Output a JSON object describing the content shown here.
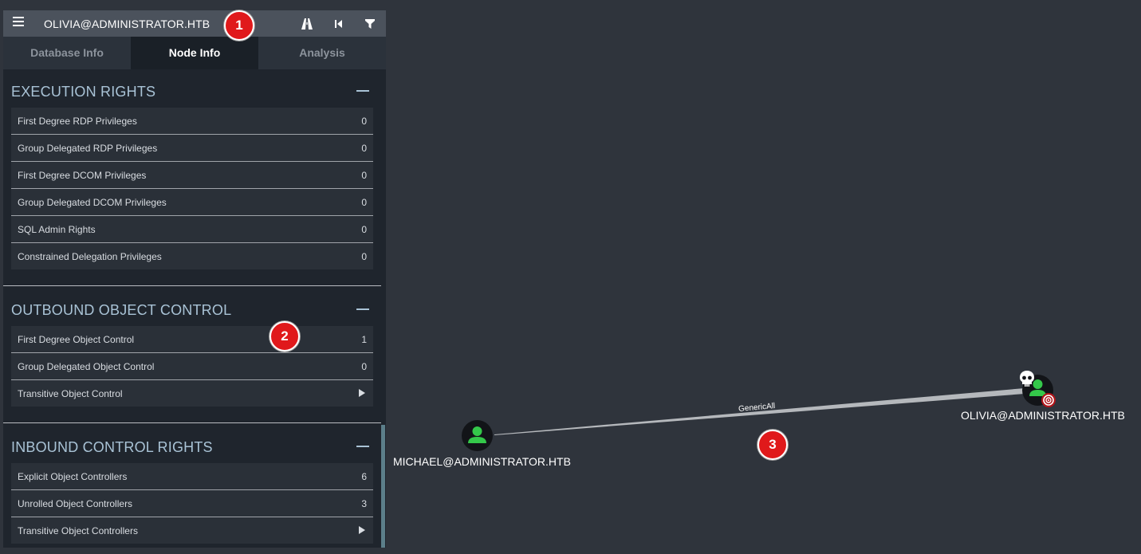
{
  "header": {
    "title": "OLIVIA@ADMINISTRATOR.HTB"
  },
  "tabs": [
    {
      "label": "Database Info",
      "active": false
    },
    {
      "label": "Node Info",
      "active": true
    },
    {
      "label": "Analysis",
      "active": false
    }
  ],
  "sections": {
    "execution": {
      "title": "EXECUTION RIGHTS",
      "rows": [
        {
          "label": "First Degree RDP Privileges",
          "value": "0"
        },
        {
          "label": "Group Delegated RDP Privileges",
          "value": "0"
        },
        {
          "label": "First Degree DCOM Privileges",
          "value": "0"
        },
        {
          "label": "Group Delegated DCOM Privileges",
          "value": "0"
        },
        {
          "label": "SQL Admin Rights",
          "value": "0"
        },
        {
          "label": "Constrained Delegation Privileges",
          "value": "0"
        }
      ]
    },
    "outbound": {
      "title": "OUTBOUND OBJECT CONTROL",
      "rows": [
        {
          "label": "First Degree Object Control",
          "value": "1"
        },
        {
          "label": "Group Delegated Object Control",
          "value": "0"
        },
        {
          "label": "Transitive Object Control",
          "value": ""
        }
      ]
    },
    "inbound": {
      "title": "INBOUND CONTROL RIGHTS",
      "rows": [
        {
          "label": "Explicit Object Controllers",
          "value": "6"
        },
        {
          "label": "Unrolled Object Controllers",
          "value": "3"
        },
        {
          "label": "Transitive Object Controllers",
          "value": ""
        }
      ]
    }
  },
  "badges": {
    "one": "1",
    "two": "2",
    "three": "3"
  },
  "graph": {
    "source_node": "MICHAEL@ADMINISTRATOR.HTB",
    "target_node": "OLIVIA@ADMINISTRATOR.HTB",
    "edge_label": "GenericAll"
  },
  "icons": {
    "menu": "hamburger-icon",
    "pathfinding": "road-icon",
    "back": "step-back-icon",
    "filter": "filter-icon",
    "user": "user-icon",
    "owned": "skull-icon",
    "target": "target-icon"
  },
  "colors": {
    "badge": "#e0191b",
    "user_node": "#34c84a",
    "section_heading": "#a9c3d6",
    "canvas": "#2f343c"
  }
}
